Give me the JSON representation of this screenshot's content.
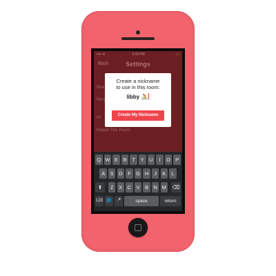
{
  "colors": {
    "phone_body": "#f1646d",
    "screen_bg": "#6b1f22",
    "modal_bg": "#ffffff",
    "primary_button": "#f0444c",
    "keyboard_bg": "#242628",
    "key_bg": "#5a5c5f"
  },
  "status_bar": {
    "carrier": "•••• ≋",
    "time": "3:30 PM",
    "battery": "▭"
  },
  "nav": {
    "back": "Back",
    "title": "Settings"
  },
  "background_rows": [
    "Nick",
    "Pers",
    "Hi",
    "Report This Room"
  ],
  "dialog": {
    "prompt_line1": "Create a nickname",
    "prompt_line2": "to use in this room:",
    "input_value": "libby 🚴",
    "button_label": "Create My Nickname"
  },
  "keyboard": {
    "row1": [
      "Q",
      "W",
      "E",
      "R",
      "T",
      "Y",
      "U",
      "I",
      "O",
      "P"
    ],
    "row2": [
      "A",
      "S",
      "D",
      "F",
      "G",
      "H",
      "J",
      "K",
      "L"
    ],
    "row3": [
      "Z",
      "X",
      "C",
      "V",
      "B",
      "N",
      "M"
    ],
    "shift": "⬆",
    "delete": "⌫",
    "numbers": "123",
    "globe": "🌐",
    "mic": "🎤",
    "space": "space",
    "return": "return"
  },
  "icons": [
    "camera-icon",
    "speaker-icon",
    "home-button-icon",
    "shift-icon",
    "delete-icon",
    "globe-icon",
    "mic-icon"
  ]
}
